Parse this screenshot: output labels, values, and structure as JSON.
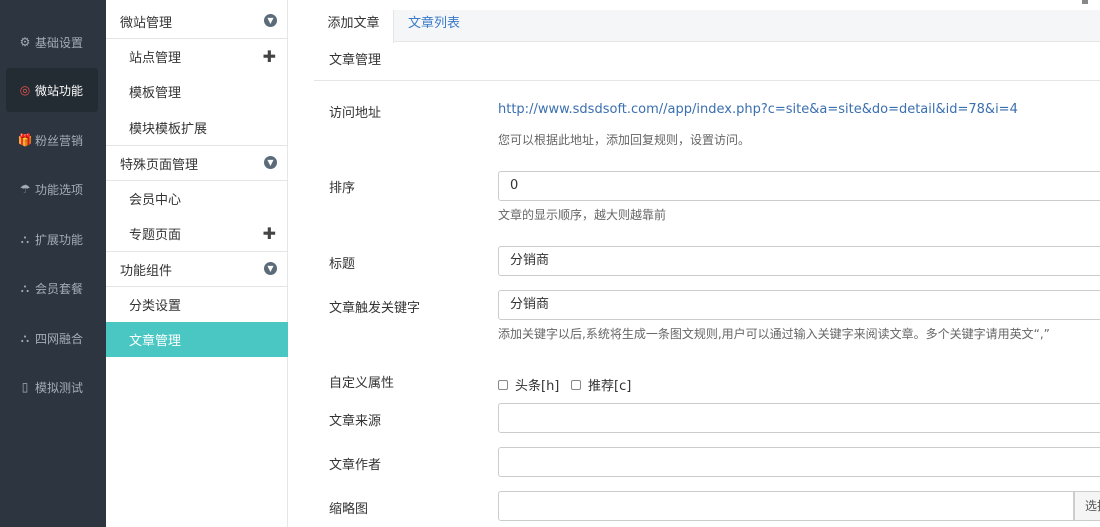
{
  "nav": {
    "items": [
      {
        "icon": "⚙",
        "label": "基础设置",
        "active": false
      },
      {
        "icon": "◎",
        "label": "微站功能",
        "active": true
      },
      {
        "icon": "🎁",
        "label": "粉丝营销",
        "active": false
      },
      {
        "icon": "☂",
        "label": "功能选项",
        "active": false
      },
      {
        "icon": "⛬",
        "label": "扩展功能",
        "active": false
      },
      {
        "icon": "⛬",
        "label": "会员套餐",
        "active": false
      },
      {
        "icon": "⛬",
        "label": "四网融合",
        "active": false
      },
      {
        "icon": "▯",
        "label": "模拟测试",
        "active": false
      }
    ]
  },
  "menu": {
    "group1": {
      "label": "微站管理"
    },
    "g1_items": [
      {
        "label": "站点管理",
        "plus": "✚"
      },
      {
        "label": "模板管理"
      },
      {
        "label": "模块模板扩展"
      }
    ],
    "group2": {
      "label": "特殊页面管理"
    },
    "g2_items": [
      {
        "label": "会员中心"
      },
      {
        "label": "专题页面",
        "plus": "✚"
      }
    ],
    "group3": {
      "label": "功能组件"
    },
    "g3_items": [
      {
        "label": "分类设置"
      },
      {
        "label": "文章管理"
      }
    ],
    "chevron": "▼"
  },
  "tabs": {
    "add": "添加文章",
    "list": "文章列表"
  },
  "panel": {
    "title": "文章管理"
  },
  "form": {
    "url_label": "访问地址",
    "url_value": "http://www.sdsdsoft.com//app/index.php?c=site&a=site&do=detail&id=78&i=4",
    "url_help": "您可以根据此地址，添加回复规则，设置访问。",
    "order_label": "排序",
    "order_value": "0",
    "order_help": "文章的显示顺序，越大则越靠前",
    "title_label": "标题",
    "title_value": "分销商",
    "keyword_label": "文章触发关键字",
    "keyword_value": "分销商",
    "keyword_help": "添加关键字以后,系统将生成一条图文规则,用户可以通过输入关键字来阅读文章。多个关键字请用英文“,”",
    "attr_label": "自定义属性",
    "attr_head": "头条[h]",
    "attr_recommend": "推荐[c]",
    "source_label": "文章来源",
    "author_label": "文章作者",
    "thumb_label": "缩略图",
    "thumb_button": "选择图片"
  }
}
